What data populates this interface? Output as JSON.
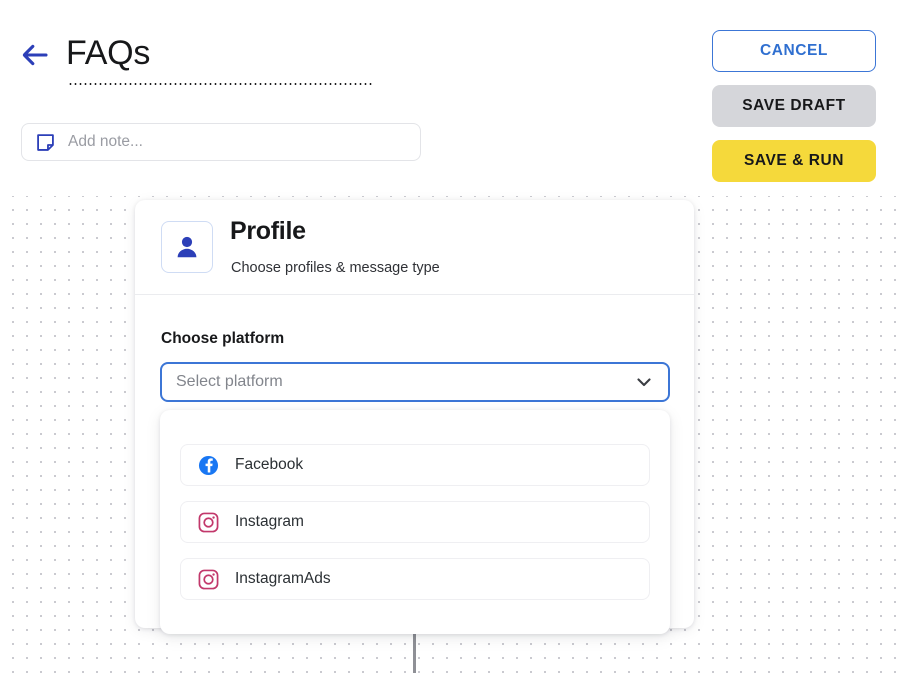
{
  "header": {
    "back_icon": "back-arrow-icon",
    "title": "FAQs",
    "note_icon": "note-icon",
    "note_placeholder": "Add note...",
    "note_value": ""
  },
  "actions": {
    "cancel_label": "CANCEL",
    "save_draft_label": "SAVE DRAFT",
    "save_run_label": "SAVE & RUN"
  },
  "profile_card": {
    "avatar_icon": "person-icon",
    "heading": "Profile",
    "subtitle": "Choose profiles & message type",
    "field_label": "Choose platform",
    "select_placeholder": "Select platform",
    "select_value": "Select platform",
    "chevron_icon": "chevron-down-icon"
  },
  "dropdown": {
    "options": [
      {
        "label": "Facebook",
        "icon": "facebook-icon"
      },
      {
        "label": "Instagram",
        "icon": "instagram-icon"
      },
      {
        "label": "InstagramAds",
        "icon": "instagram-icon"
      }
    ]
  },
  "colors": {
    "accent_blue": "#2f6fd0",
    "brand_blue": "#2c3fb8",
    "save_run_yellow": "#f5d93b",
    "save_draft_gray": "#d5d6da",
    "facebook_blue": "#1977f3",
    "instagram_crimson": "#c2386b",
    "canvas_dot": "#c9c9cf"
  }
}
